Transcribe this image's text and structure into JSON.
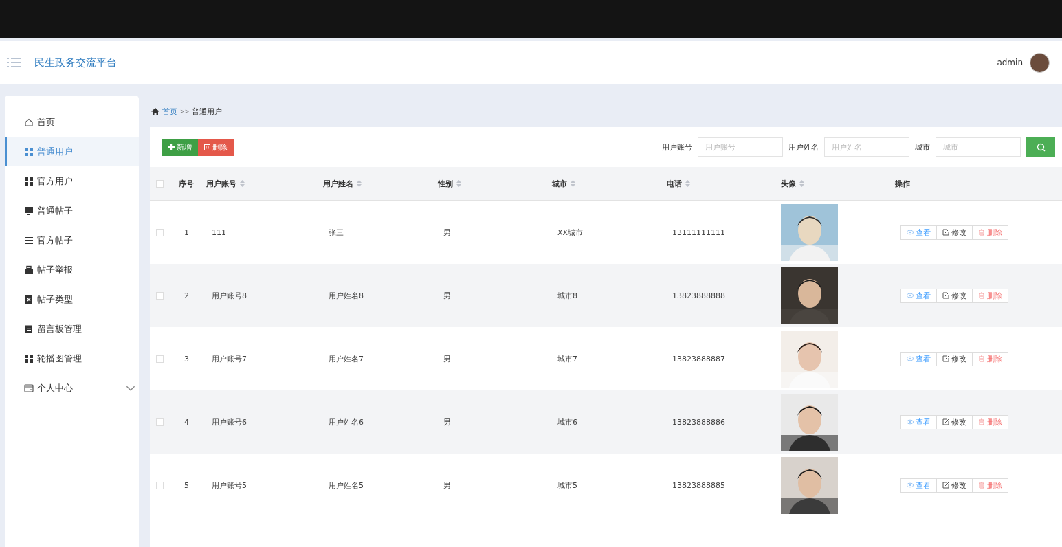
{
  "header": {
    "title": "民生政务交流平台",
    "user": "admin"
  },
  "sidebar": {
    "items": [
      {
        "label": "首页",
        "selected": false
      },
      {
        "label": "普通用户",
        "selected": true
      },
      {
        "label": "官方用户",
        "selected": false
      },
      {
        "label": "普通帖子",
        "selected": false
      },
      {
        "label": "官方帖子",
        "selected": false
      },
      {
        "label": "帖子举报",
        "selected": false
      },
      {
        "label": "帖子类型",
        "selected": false
      },
      {
        "label": "留言板管理",
        "selected": false
      },
      {
        "label": "轮播图管理",
        "selected": false
      },
      {
        "label": "个人中心",
        "selected": false,
        "expanded": false
      }
    ]
  },
  "breadcrumb": {
    "home": "首页",
    "separator": ">>",
    "current": "普通用户"
  },
  "toolbar": {
    "add": "新增",
    "delete": "删除",
    "filters": [
      {
        "label": "用户账号",
        "placeholder": "用户账号"
      },
      {
        "label": "用户姓名",
        "placeholder": "用户姓名"
      },
      {
        "label": "城市",
        "placeholder": "城市"
      }
    ]
  },
  "table": {
    "select_all": false,
    "columns": [
      {
        "label": "序号",
        "sortable": false
      },
      {
        "label": "用户账号",
        "sortable": true
      },
      {
        "label": "用户姓名",
        "sortable": true
      },
      {
        "label": "性别",
        "sortable": true
      },
      {
        "label": "城市",
        "sortable": true
      },
      {
        "label": "电话",
        "sortable": true
      },
      {
        "label": "头像",
        "sortable": true
      },
      {
        "label": "操作",
        "sortable": false
      }
    ],
    "rows": [
      {
        "checked": false,
        "cells": [
          "1",
          "111",
          "张三",
          "男",
          "XX城市",
          "13111111111"
        ],
        "actions": [
          "查看",
          "修改",
          "删除"
        ]
      },
      {
        "checked": false,
        "cells": [
          "2",
          "用户账号8",
          "用户姓名8",
          "男",
          "城市8",
          "13823888888"
        ],
        "actions": [
          "查看",
          "修改",
          "删除"
        ]
      },
      {
        "checked": false,
        "cells": [
          "3",
          "用户账号7",
          "用户姓名7",
          "男",
          "城市7",
          "13823888887"
        ],
        "actions": [
          "查看",
          "修改",
          "删除"
        ]
      },
      {
        "checked": false,
        "cells": [
          "4",
          "用户账号6",
          "用户姓名6",
          "男",
          "城市6",
          "13823888886"
        ],
        "actions": [
          "查看",
          "修改",
          "删除"
        ]
      },
      {
        "checked": false,
        "cells": [
          "5",
          "用户账号5",
          "用户姓名5",
          "男",
          "城市5",
          "13823888885"
        ],
        "actions": [
          "查看",
          "修改",
          "删除"
        ]
      }
    ]
  }
}
